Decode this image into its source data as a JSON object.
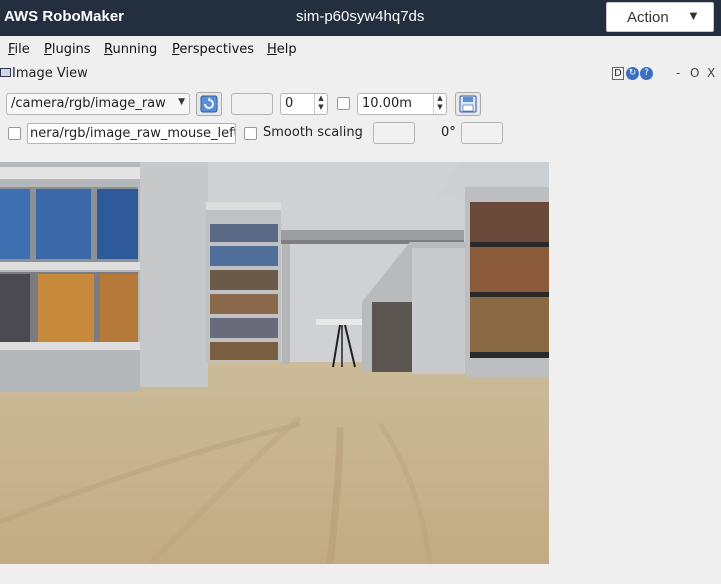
{
  "app": {
    "brand": "AWS RoboMaker",
    "sim_id": "sim-p60syw4hq7ds",
    "action_label": "Action",
    "action_caret": "▼"
  },
  "menu": [
    {
      "label": "File",
      "mn": "F",
      "rest": "ile"
    },
    {
      "label": "Plugins",
      "mn": "P",
      "rest": "lugins"
    },
    {
      "label": "Running",
      "mn": "R",
      "rest": "unning"
    },
    {
      "label": "Perspectives",
      "mn": "P",
      "rest": "erspectives"
    },
    {
      "label": "Help",
      "mn": "H",
      "rest": "elp"
    }
  ],
  "panel": {
    "title": "Image View",
    "ctrl_d": "D",
    "ctrl_minus": "-",
    "ctrl_float": "O",
    "ctrl_close": "X"
  },
  "toolbar": {
    "topic": "/camera/rgb/image_raw",
    "spin_value": "0",
    "distance": "10.00m",
    "mouse_topic": "nera/rgb/image_raw_mouse_left",
    "smooth_label": "Smooth scaling",
    "rotation": "0°"
  },
  "icons": {
    "refresh": "refresh-icon",
    "save": "save-icon",
    "dropdown": "chevron-down-icon",
    "window": "window-icon"
  },
  "colors": {
    "topbar": "#232f3e",
    "floor": "#c8b48f",
    "wall": "#cfd1d4"
  }
}
